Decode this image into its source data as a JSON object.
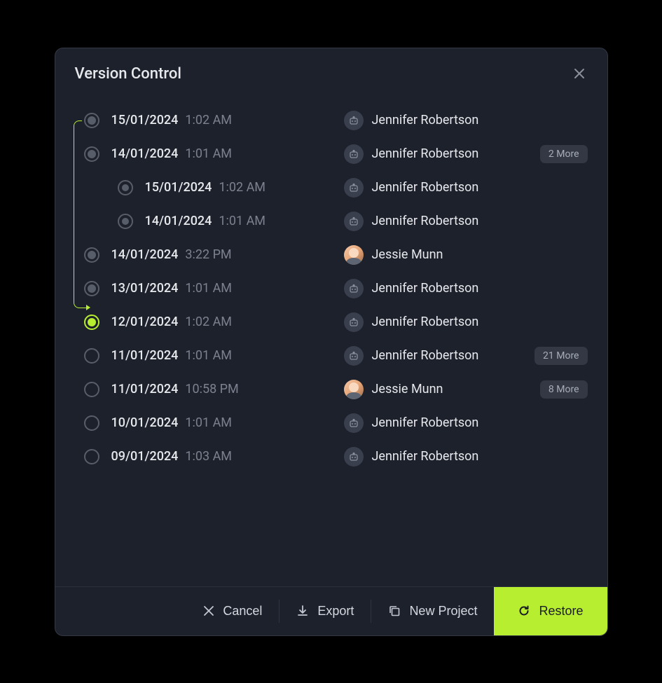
{
  "title": "Version Control",
  "versions": [
    {
      "date": "15/01/2024",
      "time": "1:02 AM",
      "author": "Jennifer Robertson",
      "avatarType": "bot",
      "indent": 0,
      "marker": "filled",
      "more": null
    },
    {
      "date": "14/01/2024",
      "time": "1:01 AM",
      "author": "Jennifer Robertson",
      "avatarType": "bot",
      "indent": 0,
      "marker": "filled",
      "more": "2 More"
    },
    {
      "date": "15/01/2024",
      "time": "1:02 AM",
      "author": "Jennifer Robertson",
      "avatarType": "bot",
      "indent": 1,
      "marker": "sm-filled",
      "more": null
    },
    {
      "date": "14/01/2024",
      "time": "1:01 AM",
      "author": "Jennifer Robertson",
      "avatarType": "bot",
      "indent": 1,
      "marker": "sm-filled",
      "more": null
    },
    {
      "date": "14/01/2024",
      "time": "3:22 PM",
      "author": "Jessie Munn",
      "avatarType": "photo",
      "indent": 0,
      "marker": "filled",
      "more": null
    },
    {
      "date": "13/01/2024",
      "time": "1:01 AM",
      "author": "Jennifer Robertson",
      "avatarType": "bot",
      "indent": 0,
      "marker": "filled",
      "more": null
    },
    {
      "date": "12/01/2024",
      "time": "1:02 AM",
      "author": "Jennifer Robertson",
      "avatarType": "bot",
      "indent": 0,
      "marker": "selected",
      "more": null
    },
    {
      "date": "11/01/2024",
      "time": "1:01 AM",
      "author": "Jennifer Robertson",
      "avatarType": "bot",
      "indent": 0,
      "marker": "empty",
      "more": "21 More"
    },
    {
      "date": "11/01/2024",
      "time": "10:58 PM",
      "author": "Jessie Munn",
      "avatarType": "photo",
      "indent": 0,
      "marker": "empty",
      "more": "8 More"
    },
    {
      "date": "10/01/2024",
      "time": "1:01 AM",
      "author": "Jennifer Robertson",
      "avatarType": "bot",
      "indent": 0,
      "marker": "empty",
      "more": null
    },
    {
      "date": "09/01/2024",
      "time": "1:03 AM",
      "author": "Jennifer Robertson",
      "avatarType": "bot",
      "indent": 0,
      "marker": "empty",
      "more": null
    }
  ],
  "footer": {
    "cancel": "Cancel",
    "export": "Export",
    "newProject": "New Project",
    "restore": "Restore"
  },
  "colors": {
    "accent": "#b7ee2f",
    "background": "#1d212c"
  }
}
